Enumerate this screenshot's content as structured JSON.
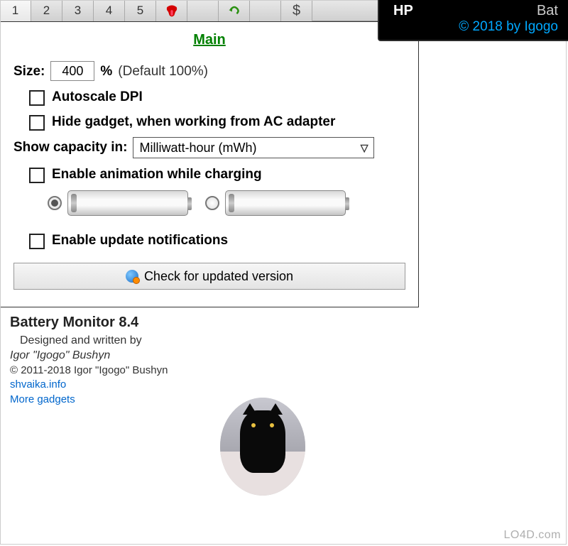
{
  "tabs": {
    "t1": "1",
    "t2": "2",
    "t3": "3",
    "t4": "4",
    "t5": "5"
  },
  "main": {
    "title": "Main",
    "size_label": "Size:",
    "size_value": "400",
    "size_unit": "%",
    "size_hint": "(Default 100%)",
    "autoscale": "Autoscale DPI",
    "hide_gadget": "Hide gadget, when working from AC adapter",
    "capacity_label": "Show capacity in:",
    "capacity_value": "Milliwatt-hour (mWh)",
    "enable_anim": "Enable animation while charging",
    "enable_updates": "Enable update notifications",
    "check_btn": "Check for updated version"
  },
  "about": {
    "title": "Battery Monitor 8.4",
    "designed": "Designed and written by",
    "author": "Igor \"Igogo\" Bushyn",
    "copyright": "© 2011-2018 Igor \"Igogo\" Bushyn",
    "link1": "shvaika.info",
    "link2": "More gadgets"
  },
  "overlay": {
    "hp": "HP",
    "bat": "Bat",
    "copy": "© 2018 by Igogo"
  },
  "watermark": "LO4D.com"
}
